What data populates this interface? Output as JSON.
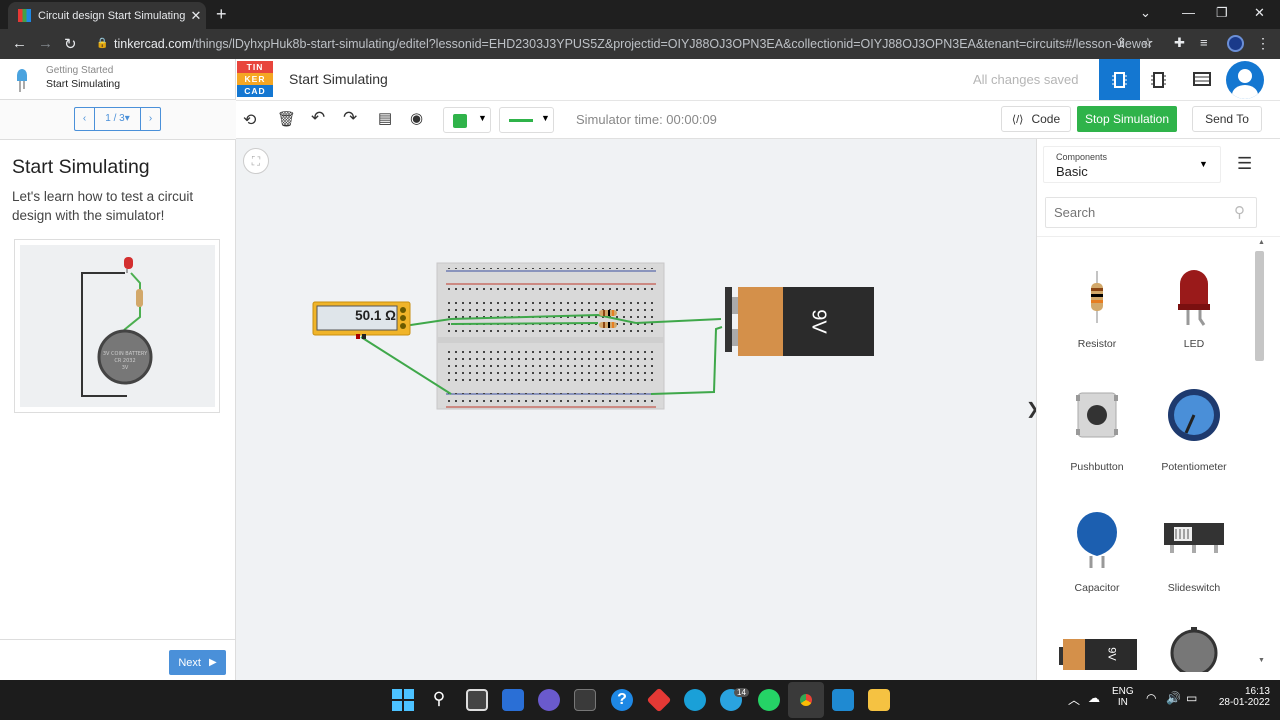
{
  "browser": {
    "tab_title": "Circuit design Start Simulating | T",
    "url_host": "tinkercad.com",
    "url_path": "/things/lDyhxpHuk8b-start-simulating/editel?lessonid=EHD2303J3YPUS5Z&projectid=OIYJ88OJ3OPN3EA&collectionid=OIYJ88OJ3OPN3EA&tenant=circuits#/lesson-viewer"
  },
  "lesson": {
    "breadcrumb_top": "Getting Started",
    "breadcrumb_current": "Start Simulating",
    "pager": "1 / 3",
    "title": "Start Simulating",
    "description": "Let's learn how to test a circuit design with the simulator!",
    "next_label": "Next",
    "coin_cell_text": "3V COIN BATTERY",
    "coin_cell_sub": "CR 2032",
    "coin_cell_volt": "3V"
  },
  "header": {
    "logo": [
      "TIN",
      "KER",
      "CAD"
    ],
    "project_title": "Start Simulating",
    "save_status": "All changes saved"
  },
  "toolbar": {
    "simulator_time": "Simulator time: 00:00:09",
    "code_label": "Code",
    "stop_label": "Stop Simulation",
    "send_label": "Send To",
    "fill_color": "#2fb34a",
    "wire_color": "#2fb34a"
  },
  "circuit": {
    "multimeter_reading": "50.1 Ω",
    "battery_label": "9V"
  },
  "components_panel": {
    "heading": "Components",
    "selected": "Basic",
    "search_placeholder": "Search",
    "items": [
      {
        "label": "Resistor"
      },
      {
        "label": "LED"
      },
      {
        "label": "Pushbutton"
      },
      {
        "label": "Potentiometer"
      },
      {
        "label": "Capacitor"
      },
      {
        "label": "Slideswitch"
      }
    ],
    "partial_battery_label": "9V"
  },
  "taskbar": {
    "lang": "ENG",
    "region": "IN",
    "time": "16:13",
    "date": "28-01-2022",
    "telegram_badge": "14"
  },
  "colors": {
    "accent_blue": "#1477d1",
    "stop_green": "#2fb34a",
    "next_blue": "#4a90d9"
  }
}
